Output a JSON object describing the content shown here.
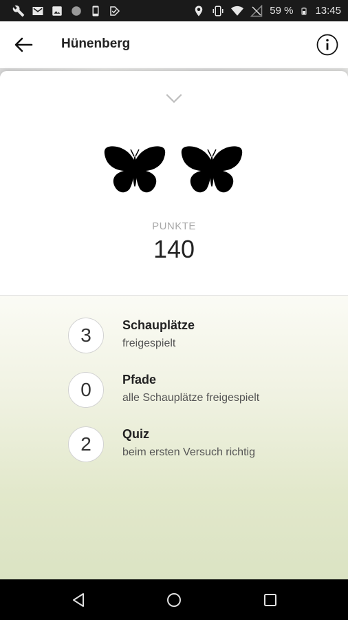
{
  "status_bar": {
    "left_icons": [
      "wrench-icon",
      "mail-icon",
      "image-icon",
      "circle-icon",
      "phone-icon",
      "check-icon"
    ],
    "right_icons": [
      "location-icon",
      "vibrate-icon",
      "wifi-icon",
      "signal-off-icon",
      "battery-icon"
    ],
    "battery_percent": "59 %",
    "time": "13:45"
  },
  "app_bar": {
    "title": "Hünenberg",
    "back_icon": "arrow-back-icon",
    "info_icon": "info-icon"
  },
  "sheet": {
    "collapse_icon": "chevron-down-icon",
    "badge_icons": [
      "butterfly-icon",
      "butterfly-icon"
    ],
    "points_label": "PUNKTE",
    "points_value": "140",
    "stats": [
      {
        "count": "3",
        "title": "Schauplätze",
        "subtitle": "freigespielt"
      },
      {
        "count": "0",
        "title": "Pfade",
        "subtitle": "alle Schauplätze freigespielt"
      },
      {
        "count": "2",
        "title": "Quiz",
        "subtitle": "beim ersten Versuch richtig"
      }
    ]
  },
  "nav_bar": {
    "buttons": [
      "back-triangle-icon",
      "home-circle-icon",
      "recents-square-icon"
    ]
  },
  "colors": {
    "status_bar_bg": "#1a1a1a",
    "gradient_bottom": "#dbe3c3",
    "nav_bar_bg": "#000000"
  }
}
